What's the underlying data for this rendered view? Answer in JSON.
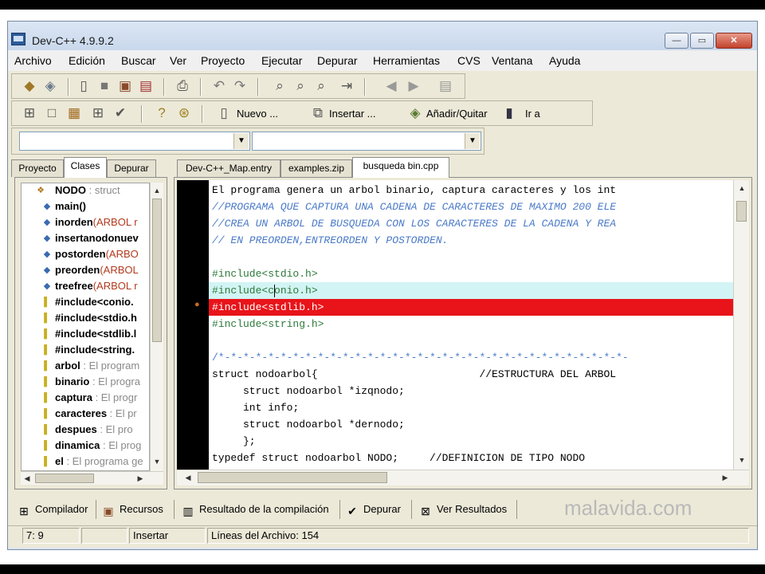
{
  "window": {
    "title": "Dev-C++ 4.9.9.2"
  },
  "titlebar_buttons": {
    "minimize": "—",
    "maximize": "▭",
    "close": "✕"
  },
  "menu": [
    "Archivo",
    "Edición",
    "Buscar",
    "Ver",
    "Proyecto",
    "Ejecutar",
    "Depurar",
    "Herramientas",
    "CVS",
    "Ventana",
    "Ayuda"
  ],
  "toolbar2": {
    "new_label": "Nuevo ...",
    "insert_label": "Insertar ...",
    "addremove_label": "Añadir/Quitar",
    "goto_label": "Ir a"
  },
  "left_tabs": [
    "Proyecto",
    "Clases",
    "Depurar"
  ],
  "editor_tabs": [
    "Dev-C++_Map.entry",
    "examples.zip",
    "busqueda bin.cpp"
  ],
  "tree": [
    {
      "name": "NODO",
      "type": " : struct"
    },
    {
      "name": "main()",
      "type": ""
    },
    {
      "name": "inorden",
      "type": "(ARBOL r"
    },
    {
      "name": "insertanodonuev",
      "type": ""
    },
    {
      "name": "postorden",
      "type": "(ARBO"
    },
    {
      "name": "preorden",
      "type": "(ARBOL"
    },
    {
      "name": "treefree",
      "type": "(ARBOL r"
    },
    {
      "name": "#include<conio.",
      "type": ""
    },
    {
      "name": "#include<stdio.h",
      "type": ""
    },
    {
      "name": "#include<stdlib.l",
      "type": ""
    },
    {
      "name": "#include<string.",
      "type": ""
    },
    {
      "name": "arbol",
      "type": " : El program"
    },
    {
      "name": "binario",
      "type": " : El progra"
    },
    {
      "name": "captura",
      "type": " : El progr"
    },
    {
      "name": "caracteres",
      "type": " : El pr"
    },
    {
      "name": "despues",
      "type": " : El pro"
    },
    {
      "name": "dinamica",
      "type": " : El prog"
    },
    {
      "name": "el",
      "type": " : El programa ge"
    }
  ],
  "code": [
    "El programa genera un arbol binario, captura caracteres y los int",
    "//PROGRAMA QUE CAPTURA UNA CADENA DE CARACTERES DE MAXIMO 200 ELE",
    "//CREA UN ARBOL DE BUSQUEDA CON LOS CARACTERES DE LA CADENA Y REA",
    "// EN PREORDEN,ENTREORDEN Y POSTORDEN.",
    "",
    "#include<stdio.h>",
    "#include<conio.h>",
    "#include<stdlib.h>",
    "#include<string.h>",
    "",
    "/*-*-*-*-*-*-*-*-*-*-*-*-*-*-*-*-*-*-*-*-*-*-*-*-*-*-*-*-*-*-*-*-*-",
    "struct nodoarbol{                          //ESTRUCTURA DEL ARBOL",
    "     struct nodoarbol *izqnodo;",
    "     int info;",
    "     struct nodoarbol *dernodo;",
    "     };",
    "typedef struct nodoarbol NODO;     //DEFINICION DE TIPO NODO"
  ],
  "highlight_colors": {
    "cursor_line": "#d2f4f4",
    "breakpoint_line": "#e8141a",
    "gutter": "#000000"
  },
  "bottom_tabs": [
    "Compilador",
    "Recursos",
    "Resultado de la compilación",
    "Depurar",
    "Ver Resultados"
  ],
  "status": {
    "position": "7: 9",
    "mode": "Insertar",
    "lines": "Líneas del Archivo: 154"
  },
  "watermark": "malavida.com"
}
